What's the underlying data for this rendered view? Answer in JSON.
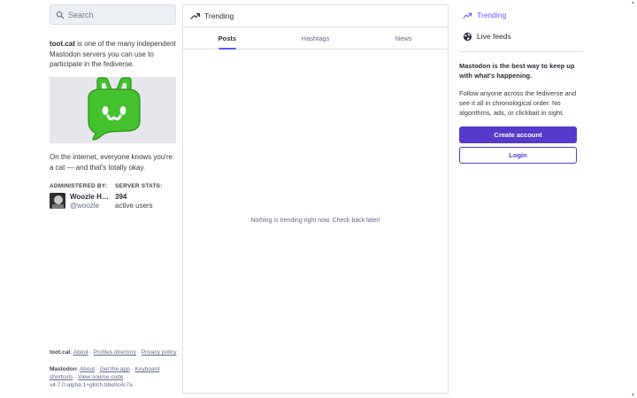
{
  "search": {
    "placeholder": "Search"
  },
  "intro": {
    "server": "toot.cat",
    "text": " is one of the many independent Mastodon servers you can use to participate in the fediverse."
  },
  "tagline": "On the internet, everyone knows you're a cat — and that's totally okay.",
  "admin": {
    "heading": "ADMINISTERED BY:",
    "name": "Woozle Hypertwin",
    "handle": "@woozle"
  },
  "stats": {
    "heading": "SERVER STATS:",
    "value": "394",
    "label": "active users"
  },
  "footer_server": {
    "name": "toot.cat",
    "sep": ": ",
    "links": [
      "About",
      "Profiles directory",
      "Privacy policy"
    ]
  },
  "footer_mastodon": {
    "name": "Mastodon",
    "sep": ": ",
    "links": [
      "About",
      "Get the app",
      "Keyboard shortcuts",
      "View source code"
    ],
    "version": "v4.7.0-alpha.1+glitch.bbe0c4c7a"
  },
  "center": {
    "title": "Trending",
    "tabs": [
      "Posts",
      "Hashtags",
      "News"
    ],
    "active_tab": "Posts",
    "empty_message": "Nothing is trending right now. Check back later!"
  },
  "nav": {
    "trending": "Trending",
    "live_feeds": "Live feeds"
  },
  "promo": {
    "title": "Mastodon is the best way to keep up with what's happening.",
    "body": "Follow anyone across the fediverse and see it all in chronological order. No algorithms, ads, or clickbait in sight.",
    "create_account": "Create account",
    "login": "Login"
  },
  "colors": {
    "accent": "#595aff",
    "button": "#563acc",
    "logo_green": "#44c22e"
  }
}
